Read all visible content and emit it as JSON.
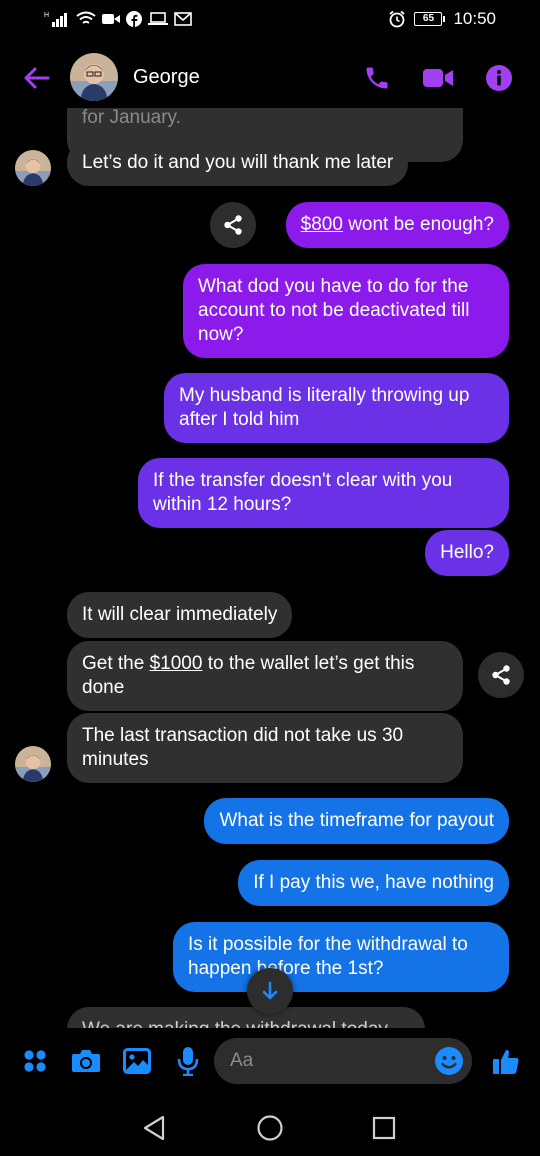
{
  "status_bar": {
    "battery": "65",
    "time": "10:50"
  },
  "header": {
    "contact_name": "George"
  },
  "colors": {
    "accent": "#a23ff0",
    "incoming": "#303030",
    "outgoing_purple": "#8c1aeb",
    "outgoing_violet": "#6a31e6",
    "outgoing_blue": "#1473e6",
    "composer_blue": "#1a8cff"
  },
  "messages": [
    {
      "direction": "in",
      "text": "for January."
    },
    {
      "direction": "in",
      "text": "Let’s do it and you will thank me later"
    },
    {
      "direction": "out",
      "link": "$800",
      "text": " wont be enough?"
    },
    {
      "direction": "out",
      "text": "What dod you have to do for the account to not be deactivated till now?"
    },
    {
      "direction": "out",
      "text": "My husband is literally throwing up after I told him"
    },
    {
      "direction": "out",
      "text": "If the transfer doesn't clear with you within 12 hours?"
    },
    {
      "direction": "out",
      "text": "Hello?"
    },
    {
      "direction": "in",
      "text": "It will clear immediately"
    },
    {
      "direction": "in",
      "prefix": "Get the ",
      "link": "$1000",
      "text": " to the wallet let’s get this done"
    },
    {
      "direction": "in",
      "text": "The last transaction did not take us 30 minutes"
    },
    {
      "direction": "out",
      "text": "What is the timeframe for payout"
    },
    {
      "direction": "out",
      "text": "If I pay this we, have nothing"
    },
    {
      "direction": "out",
      "text": "Is it possible for the withdrawal to happen before the 1st?"
    },
    {
      "direction": "in",
      "text": "We are making the withdrawal today"
    }
  ],
  "composer": {
    "placeholder": "Aa"
  },
  "icons": [
    "back-arrow-icon",
    "phone-icon",
    "video-icon",
    "info-icon",
    "share-icon",
    "arrow-down-icon",
    "menu-dots-icon",
    "camera-icon",
    "gallery-icon",
    "microphone-icon",
    "emoji-icon",
    "thumbs-up-icon",
    "nav-back-icon",
    "nav-home-icon",
    "nav-recents-icon"
  ]
}
